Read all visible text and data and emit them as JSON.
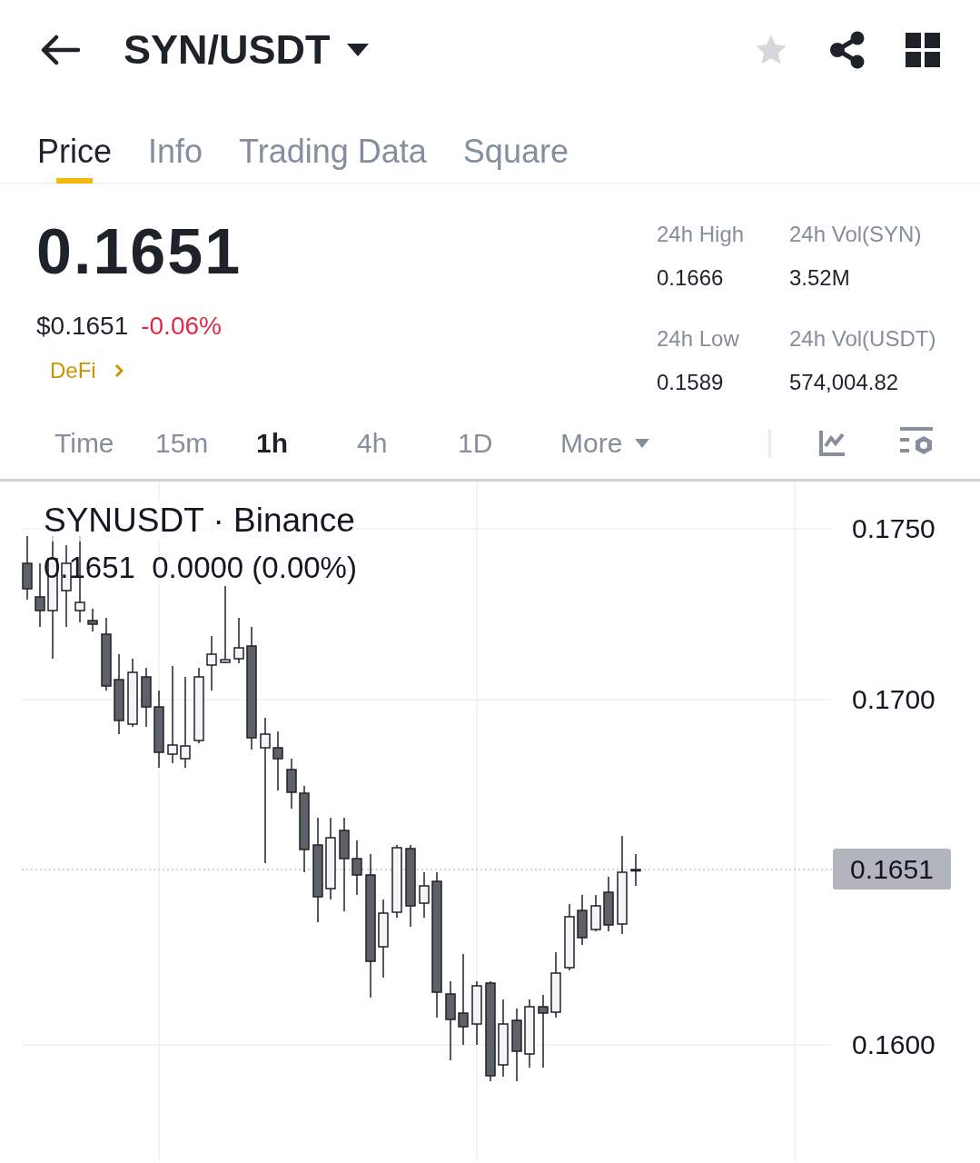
{
  "header": {
    "pair": "SYN/USDT",
    "favorite": false
  },
  "tabs": [
    {
      "label": "Price",
      "selected": true
    },
    {
      "label": "Info",
      "selected": false
    },
    {
      "label": "Trading Data",
      "selected": false
    },
    {
      "label": "Square",
      "selected": false
    }
  ],
  "price": {
    "last": "0.1651",
    "usd": "$0.1651",
    "change": "-0.06%",
    "tag": "DeFi"
  },
  "stats": [
    {
      "label": "24h High",
      "value": "0.1666"
    },
    {
      "label": "24h Vol(SYN)",
      "value": "3.52M"
    },
    {
      "label": "24h Low",
      "value": "0.1589"
    },
    {
      "label": "24h Vol(USDT)",
      "value": "574,004.82"
    }
  ],
  "intervals": [
    {
      "label": "Time",
      "selected": false
    },
    {
      "label": "15m",
      "selected": false
    },
    {
      "label": "1h",
      "selected": true
    },
    {
      "label": "4h",
      "selected": false
    },
    {
      "label": "1D",
      "selected": false
    }
  ],
  "more": {
    "label": "More"
  },
  "chart": {
    "symbol": "SYNUSDT · Binance",
    "ohlc": "0.1651  0.0000 (0.00%)",
    "price_axis": [
      {
        "label": "0.1750"
      },
      {
        "label": "0.1700"
      },
      {
        "label": "0.1600"
      }
    ],
    "last_price": "0.1651"
  }
}
